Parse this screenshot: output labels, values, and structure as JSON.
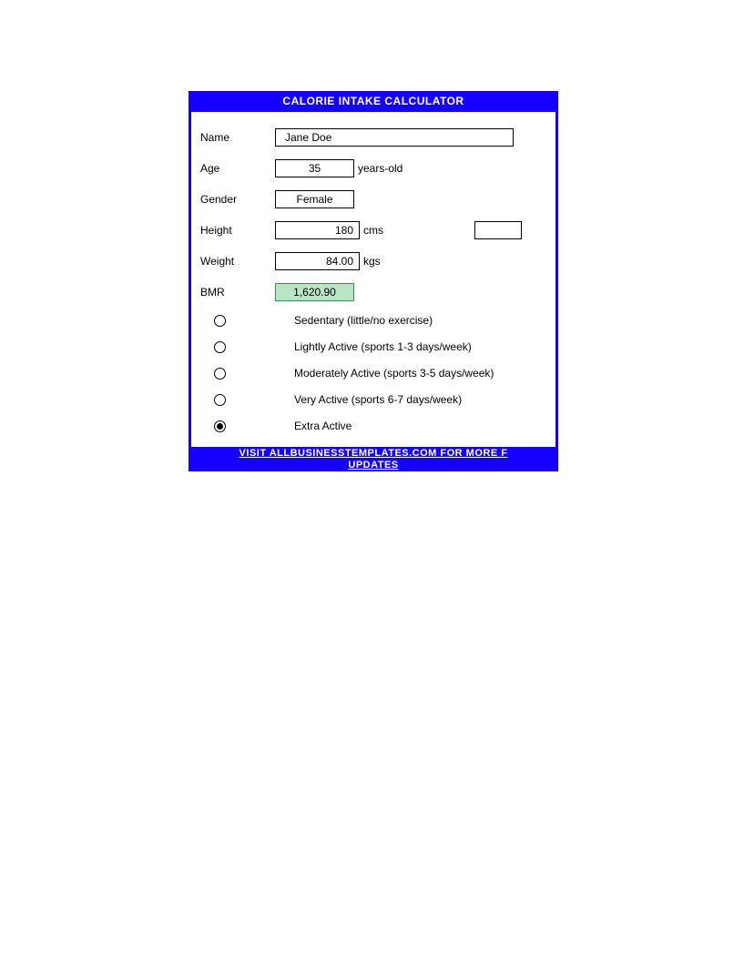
{
  "title": "CALORIE INTAKE CALCULATOR",
  "fields": {
    "name": {
      "label": "Name",
      "value": "Jane Doe"
    },
    "age": {
      "label": "Age",
      "value": "35",
      "unit": "years-old"
    },
    "gender": {
      "label": "Gender",
      "value": "Female"
    },
    "height": {
      "label": "Height",
      "value": "180",
      "unit": "cms"
    },
    "weight": {
      "label": "Weight",
      "value": "84.00",
      "unit": "kgs"
    },
    "bmr": {
      "label": "BMR",
      "value": "1,620.90"
    }
  },
  "activity": {
    "options": [
      {
        "label": "Sedentary (little/no exercise)",
        "selected": false
      },
      {
        "label": "Lightly Active (sports 1-3 days/week)",
        "selected": false
      },
      {
        "label": "Moderately Active (sports 3-5 days/week)",
        "selected": false
      },
      {
        "label": "Very Active (sports 6-7 days/week)",
        "selected": false
      },
      {
        "label": "Extra Active",
        "selected": true
      }
    ]
  },
  "footer": {
    "line1": "VISIT ALLBUSINESSTEMPLATES.COM FOR MORE F",
    "line2": "UPDATES"
  }
}
